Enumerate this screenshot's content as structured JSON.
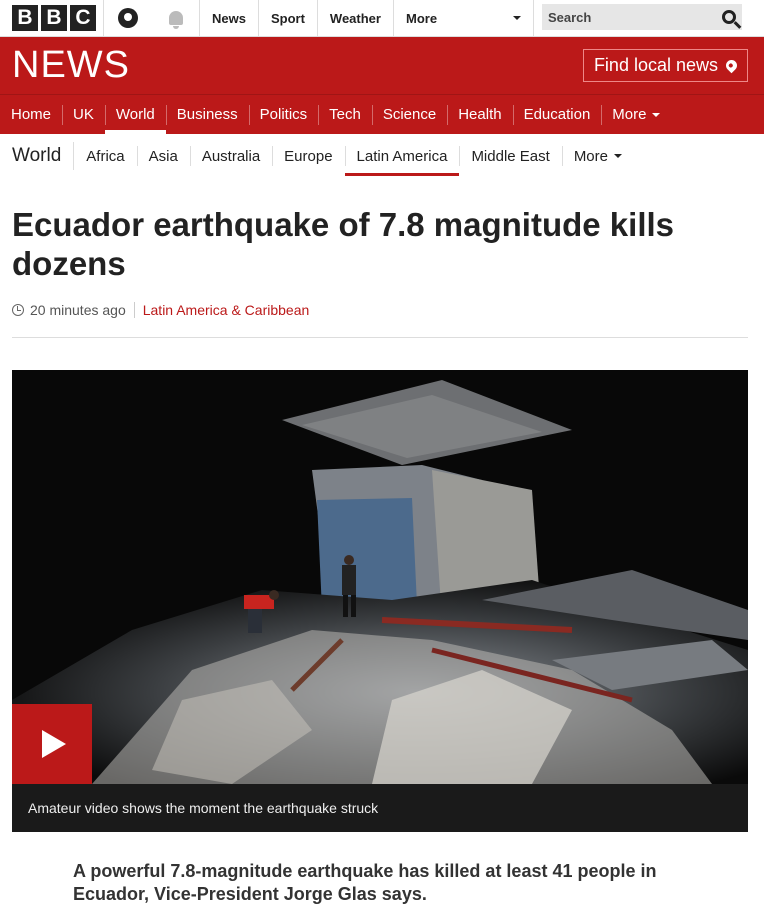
{
  "brand": {
    "letters": [
      "B",
      "B",
      "C"
    ],
    "news_wordmark": "NEWS",
    "find_local": "Find local news"
  },
  "topnav": {
    "items": [
      "News",
      "Sport",
      "Weather",
      "More"
    ],
    "search_placeholder": "Search"
  },
  "mainnav": {
    "items": [
      "Home",
      "UK",
      "World",
      "Business",
      "Politics",
      "Tech",
      "Science",
      "Health",
      "Education",
      "More"
    ],
    "active": "World"
  },
  "subnav": {
    "section": "World",
    "items": [
      "Africa",
      "Asia",
      "Australia",
      "Europe",
      "Latin America",
      "Middle East",
      "More"
    ],
    "active": "Latin America"
  },
  "article": {
    "headline": "Ecuador earthquake of 7.8 magnitude kills dozens",
    "time": "20 minutes ago",
    "category": "Latin America & Caribbean",
    "video_caption": "Amateur video shows the moment the earthquake struck",
    "intro": "A powerful 7.8-magnitude earthquake has killed at least 41 people in Ecuador, Vice-President Jorge Glas says."
  },
  "colors": {
    "brand_red": "#bb1919"
  },
  "icons": [
    "account-icon",
    "notifications-icon",
    "search-icon",
    "location-pin-icon",
    "clock-icon",
    "play-icon",
    "chevron-down-icon"
  ]
}
